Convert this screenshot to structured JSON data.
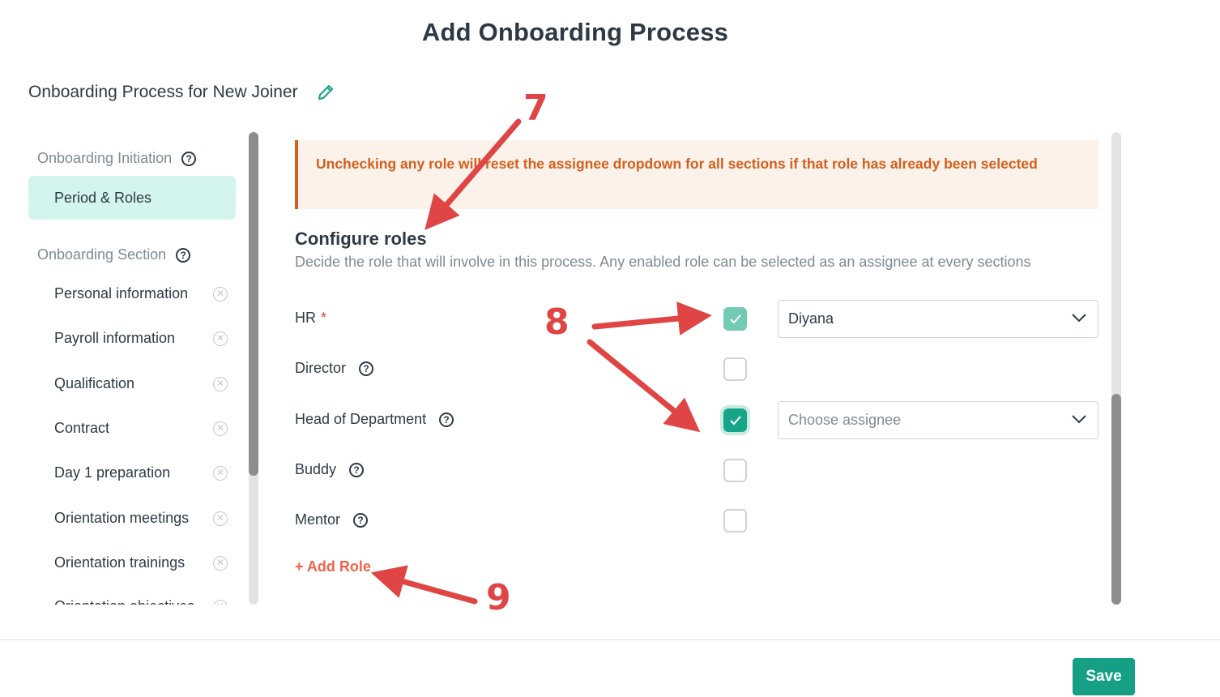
{
  "page_title": "Add Onboarding Process",
  "process_name": "Onboarding Process for New Joiner",
  "sidebar": {
    "initiation_heading": "Onboarding Initiation",
    "active_item": "Period & Roles",
    "section_heading": "Onboarding Section",
    "items": [
      {
        "label": "Personal information"
      },
      {
        "label": "Payroll information"
      },
      {
        "label": "Qualification"
      },
      {
        "label": "Contract"
      },
      {
        "label": "Day 1 preparation"
      },
      {
        "label": "Orientation meetings"
      },
      {
        "label": "Orientation trainings"
      },
      {
        "label": "Orientation objectives"
      }
    ]
  },
  "banner": {
    "text": "Unchecking any role will reset the assignee dropdown for all sections if that role has already been selected"
  },
  "configure": {
    "title": "Configure roles",
    "description": "Decide the role that will involve in this process. Any enabled role can be selected as an assignee at every sections"
  },
  "roles": [
    {
      "label": "HR",
      "required_mark": "*",
      "checked": true,
      "assignee": "Diyana"
    },
    {
      "label": "Director",
      "checked": false
    },
    {
      "label": "Head of Department",
      "checked": true,
      "assignee_placeholder": "Choose assignee"
    },
    {
      "label": "Buddy",
      "checked": false
    },
    {
      "label": "Mentor",
      "checked": false
    }
  ],
  "add_role_label": "+ Add Role",
  "save_label": "Save",
  "annotations": {
    "n7": "7",
    "n8": "8",
    "n9": "9"
  },
  "colors": {
    "accent": "#15a085",
    "warning": "#d35f1d",
    "annotation": "#e04545",
    "active_bg": "#d4f4ee"
  }
}
